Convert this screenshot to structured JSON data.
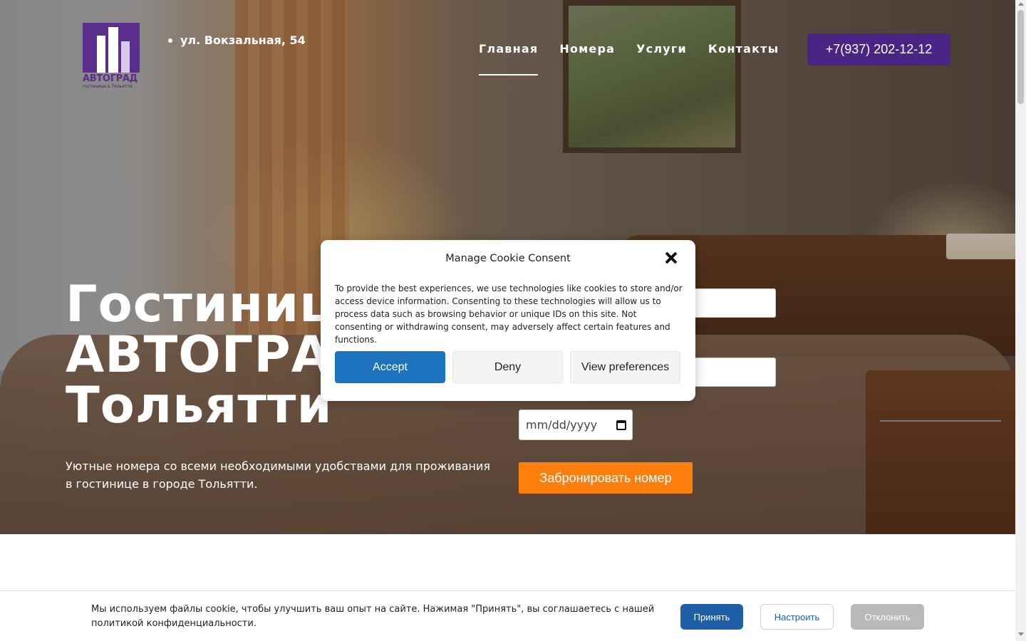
{
  "header": {
    "logo_name": "АВТОГРАД",
    "logo_sub": "гостиница в Тольятти",
    "address": "ул. Вокзальная, 54",
    "nav": [
      {
        "label": "Главная",
        "active": true
      },
      {
        "label": "Номера",
        "active": false
      },
      {
        "label": "Услуги",
        "active": false
      },
      {
        "label": "Контакты",
        "active": false
      }
    ],
    "phone": "+7(937) 202-12-12"
  },
  "hero": {
    "title_line1": "Гостиница",
    "title_line2": "АВТОГРАД",
    "title_line3": "Тольятти",
    "subtitle": "Уютные номера со всеми необходимыми удобствами для проживания в гостинице в городе Тольятти."
  },
  "booking": {
    "date_placeholder": "mm/dd/yyyy",
    "submit_label": "Забронировать номер"
  },
  "cookie_modal": {
    "title": "Manage Cookie Consent",
    "text": "To provide the best experiences, we use technologies like cookies to store and/or access device information. Consenting to these technologies will allow us to process data such as browsing behavior or unique IDs on this site. Not consenting or withdrawing consent, may adversely affect certain features and functions.",
    "accept": "Accept",
    "deny": "Deny",
    "preferences": "View preferences"
  },
  "cookie_bar": {
    "text": "Мы используем файлы cookie, чтобы улучшить ваш опыт на сайте. Нажимая \"Принять\", вы соглашаетесь с нашей политикой конфиденциальности.",
    "accept": "Принять",
    "settings": "Настроить",
    "reject": "Отклонить"
  },
  "colors": {
    "brand_purple": "#4b2585",
    "book_orange": "#ff7f0e",
    "accept_blue": "#1e73be"
  }
}
